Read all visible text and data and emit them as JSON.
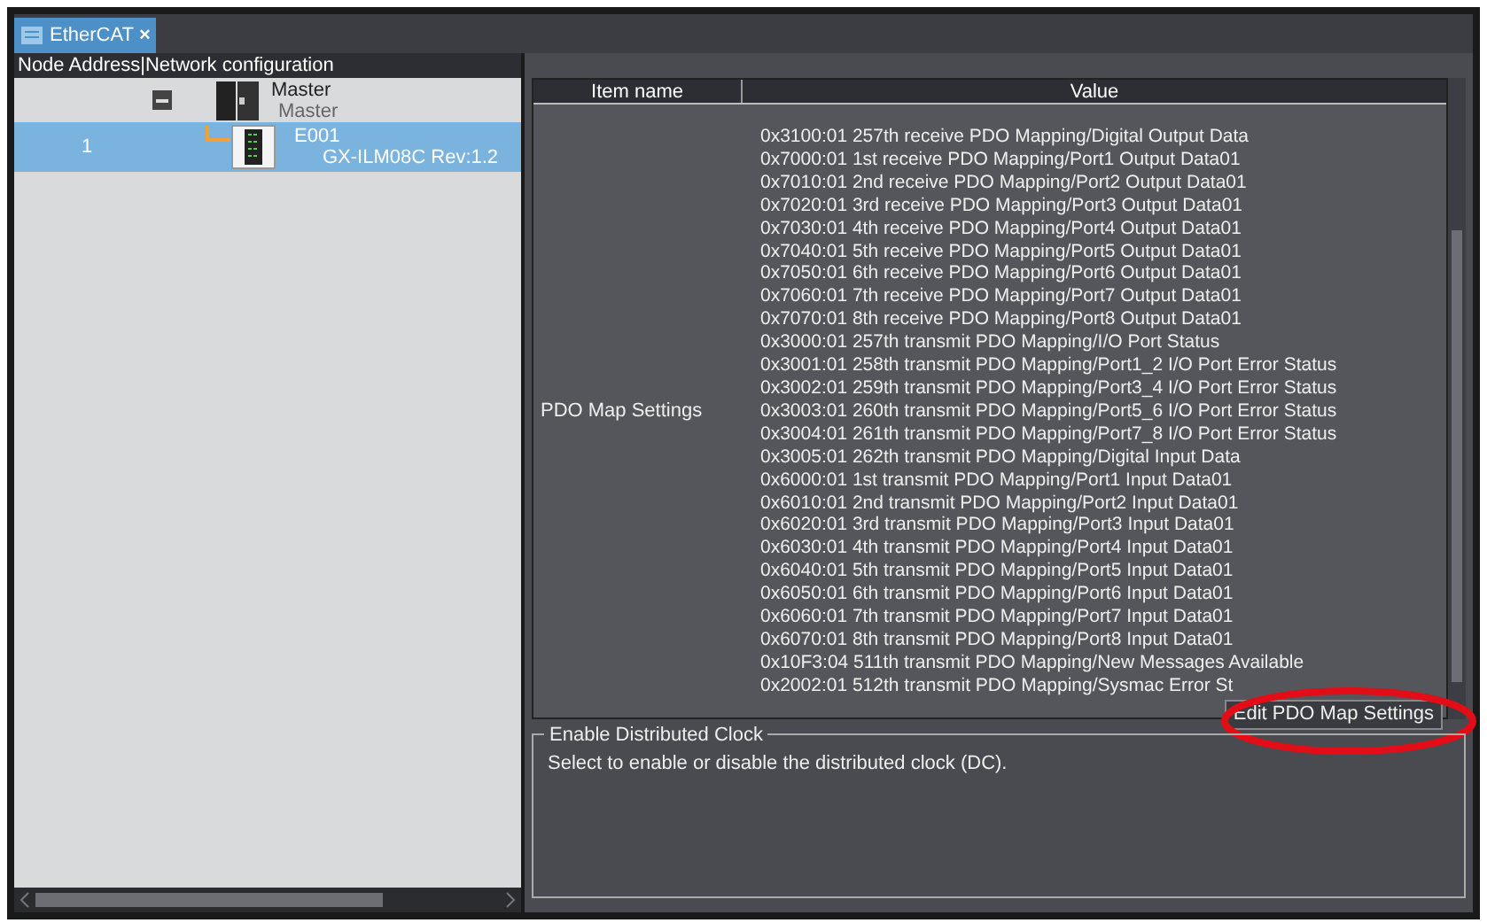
{
  "tabs": [
    {
      "label": "EtherCAT",
      "close": "×",
      "selected": true
    }
  ],
  "network": {
    "header": "Node Address|Network configuration",
    "nodes": [
      {
        "name": "Master",
        "model": "Master",
        "expanded": true,
        "selected": false,
        "children": [
          {
            "address": "1",
            "name": "E001",
            "model": "GX-ILM08C Rev:1.2",
            "selected": true
          }
        ]
      }
    ]
  },
  "table": {
    "columns": [
      "Item name",
      "Value"
    ],
    "rows": [
      {
        "item_name": "PDO Map Settings",
        "values": [
          "0x3100:01 257th receive PDO Mapping/Digital Output Data",
          "0x7000:01 1st receive PDO Mapping/Port1 Output Data01",
          "0x7010:01 2nd receive PDO Mapping/Port2 Output Data01",
          "0x7020:01 3rd receive PDO Mapping/Port3 Output Data01",
          "0x7030:01 4th receive PDO Mapping/Port4 Output Data01",
          "0x7040:01 5th receive PDO Mapping/Port5 Output Data01",
          "0x7050:01 6th receive PDO Mapping/Port6 Output Data01",
          "0x7060:01 7th receive PDO Mapping/Port7 Output Data01",
          "0x7070:01 8th receive PDO Mapping/Port8 Output Data01",
          "0x3000:01 257th transmit PDO Mapping/I/O Port Status",
          "0x3001:01 258th transmit PDO Mapping/Port1_2 I/O Port Error Status",
          "0x3002:01 259th transmit PDO Mapping/Port3_4 I/O Port Error Status",
          "0x3003:01 260th transmit PDO Mapping/Port5_6 I/O Port Error Status",
          "0x3004:01 261th transmit PDO Mapping/Port7_8 I/O Port Error Status",
          "0x3005:01 262th transmit PDO Mapping/Digital Input Data",
          "0x6000:01 1st transmit PDO Mapping/Port1 Input Data01",
          "0x6010:01 2nd transmit PDO Mapping/Port2 Input Data01",
          "0x6020:01 3rd transmit PDO Mapping/Port3 Input Data01",
          "0x6030:01 4th transmit PDO Mapping/Port4 Input Data01",
          "0x6040:01 5th transmit PDO Mapping/Port5 Input Data01",
          "0x6050:01 6th transmit PDO Mapping/Port6 Input Data01",
          "0x6060:01 7th transmit PDO Mapping/Port7 Input Data01",
          "0x6070:01 8th transmit PDO Mapping/Port8 Input Data01",
          "0x10F3:04 511th transmit PDO Mapping/New Messages Available",
          "0x2002:01 512th transmit PDO Mapping/Sysmac Error St"
        ],
        "button": "Edit PDO Map Settings",
        "highlighted": true
      }
    ]
  },
  "description": {
    "title": "Enable Distributed Clock",
    "text": "Select to enable or disable the distributed clock (DC)."
  }
}
